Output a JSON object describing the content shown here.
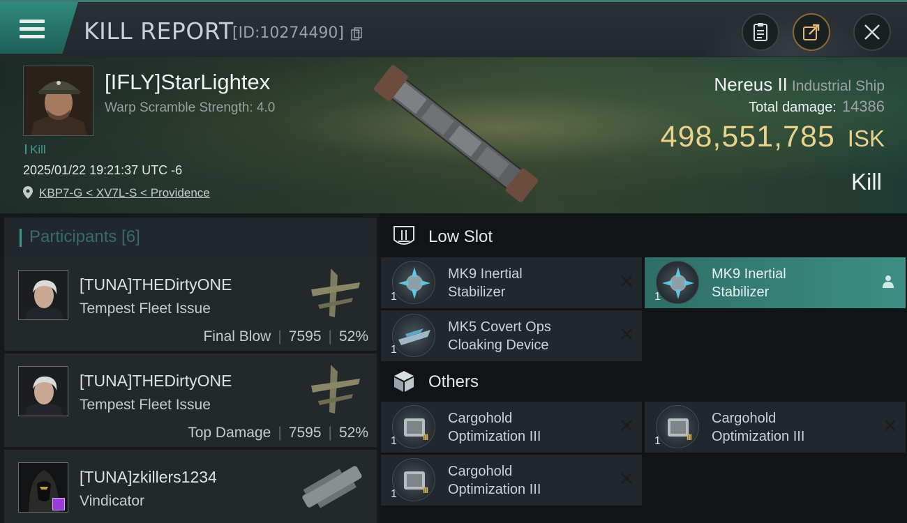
{
  "header": {
    "title": "KILL REPORT",
    "report_id": "[ID:10274490]"
  },
  "victim": {
    "name": "[IFLY]StarLightex",
    "warp_scramble": "Warp Scramble Strength: 4.0",
    "kill_tag": "Kill",
    "datetime": "2025/01/22 19:21:37 UTC -6",
    "location": "KBP7-G < XV7L-S < Providence",
    "ship_name": "Nereus II",
    "ship_class": "Industrial Ship",
    "damage_label": "Total damage:",
    "damage_value": "14386",
    "isk_value": "498,551,785",
    "isk_unit": "ISK",
    "result": "Kill"
  },
  "participants": {
    "title": "Participants [6]",
    "rows": [
      {
        "name": "[TUNA]THEDirtyONE",
        "ship": "Tempest Fleet Issue",
        "role": "Final Blow",
        "damage": "7595",
        "percent": "52%"
      },
      {
        "name": "[TUNA]THEDirtyONE",
        "ship": "Tempest Fleet Issue",
        "role": "Top Damage",
        "damage": "7595",
        "percent": "52%"
      },
      {
        "name": "[TUNA]zkillers1234",
        "ship": "Vindicator"
      }
    ]
  },
  "sections": {
    "low_slot": {
      "title": "Low Slot",
      "items": [
        {
          "name_line1": "MK9 Inertial",
          "name_line2": "Stabilizer",
          "qty": "1",
          "state": "destroyed"
        },
        {
          "name_line1": "MK9 Inertial",
          "name_line2": "Stabilizer",
          "qty": "1",
          "state": "dropped"
        },
        {
          "name_line1": "MK5 Covert Ops",
          "name_line2": "Cloaking Device",
          "qty": "1",
          "state": "destroyed"
        }
      ]
    },
    "others": {
      "title": "Others",
      "items": [
        {
          "name_line1": "Cargohold",
          "name_line2": "Optimization III",
          "qty": "1",
          "tier": "III",
          "state": "destroyed"
        },
        {
          "name_line1": "Cargohold",
          "name_line2": "Optimization III",
          "qty": "1",
          "tier": "III",
          "state": "destroyed"
        },
        {
          "name_line1": "Cargohold",
          "name_line2": "Optimization III",
          "qty": "1",
          "tier": "III",
          "state": "destroyed"
        }
      ]
    }
  },
  "colors": {
    "accent": "#3f9a8b",
    "isk": "#e9d28c",
    "highlight": "#3c8f84"
  }
}
